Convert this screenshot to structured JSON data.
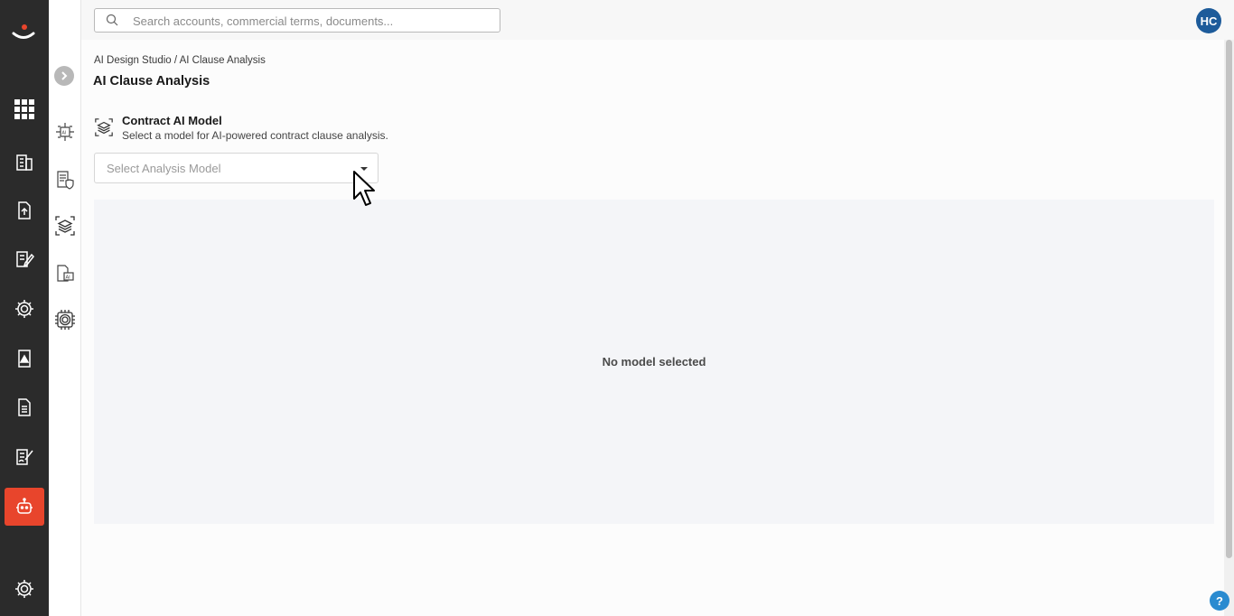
{
  "colors": {
    "rail_bg": "#2b2b2b",
    "accent": "#e8452c",
    "avatar_bg": "#1d5b9a",
    "help_bg": "#2a8bd0"
  },
  "rail": {
    "items": [
      {
        "icon": "apps-grid-icon"
      },
      {
        "icon": "buildings-icon"
      },
      {
        "icon": "document-upload-icon"
      },
      {
        "icon": "document-edit-icon"
      },
      {
        "icon": "gear-icon"
      },
      {
        "icon": "document-warning-icon"
      },
      {
        "icon": "document-list-icon"
      },
      {
        "icon": "document-sign-icon"
      },
      {
        "icon": "robot-icon",
        "active": true
      },
      {
        "icon": "settings-gear-icon"
      }
    ]
  },
  "subnav": {
    "items": [
      {
        "icon": "ai-chip-icon"
      },
      {
        "icon": "document-shield-icon"
      },
      {
        "icon": "layers-scan-icon",
        "active": true
      },
      {
        "icon": "document-ai-icon"
      },
      {
        "icon": "processor-gear-icon"
      }
    ]
  },
  "search": {
    "placeholder": "Search accounts, commercial terms, documents..."
  },
  "user": {
    "initials": "HC"
  },
  "breadcrumb": "AI Design Studio / AI Clause Analysis",
  "page": {
    "title": "AI Clause Analysis",
    "model_section": {
      "title": "Contract AI Model",
      "description": "Select a model for AI-powered contract clause analysis.",
      "select_placeholder": "Select Analysis Model"
    },
    "empty_state": "No model selected"
  },
  "help": {
    "label": "?"
  }
}
